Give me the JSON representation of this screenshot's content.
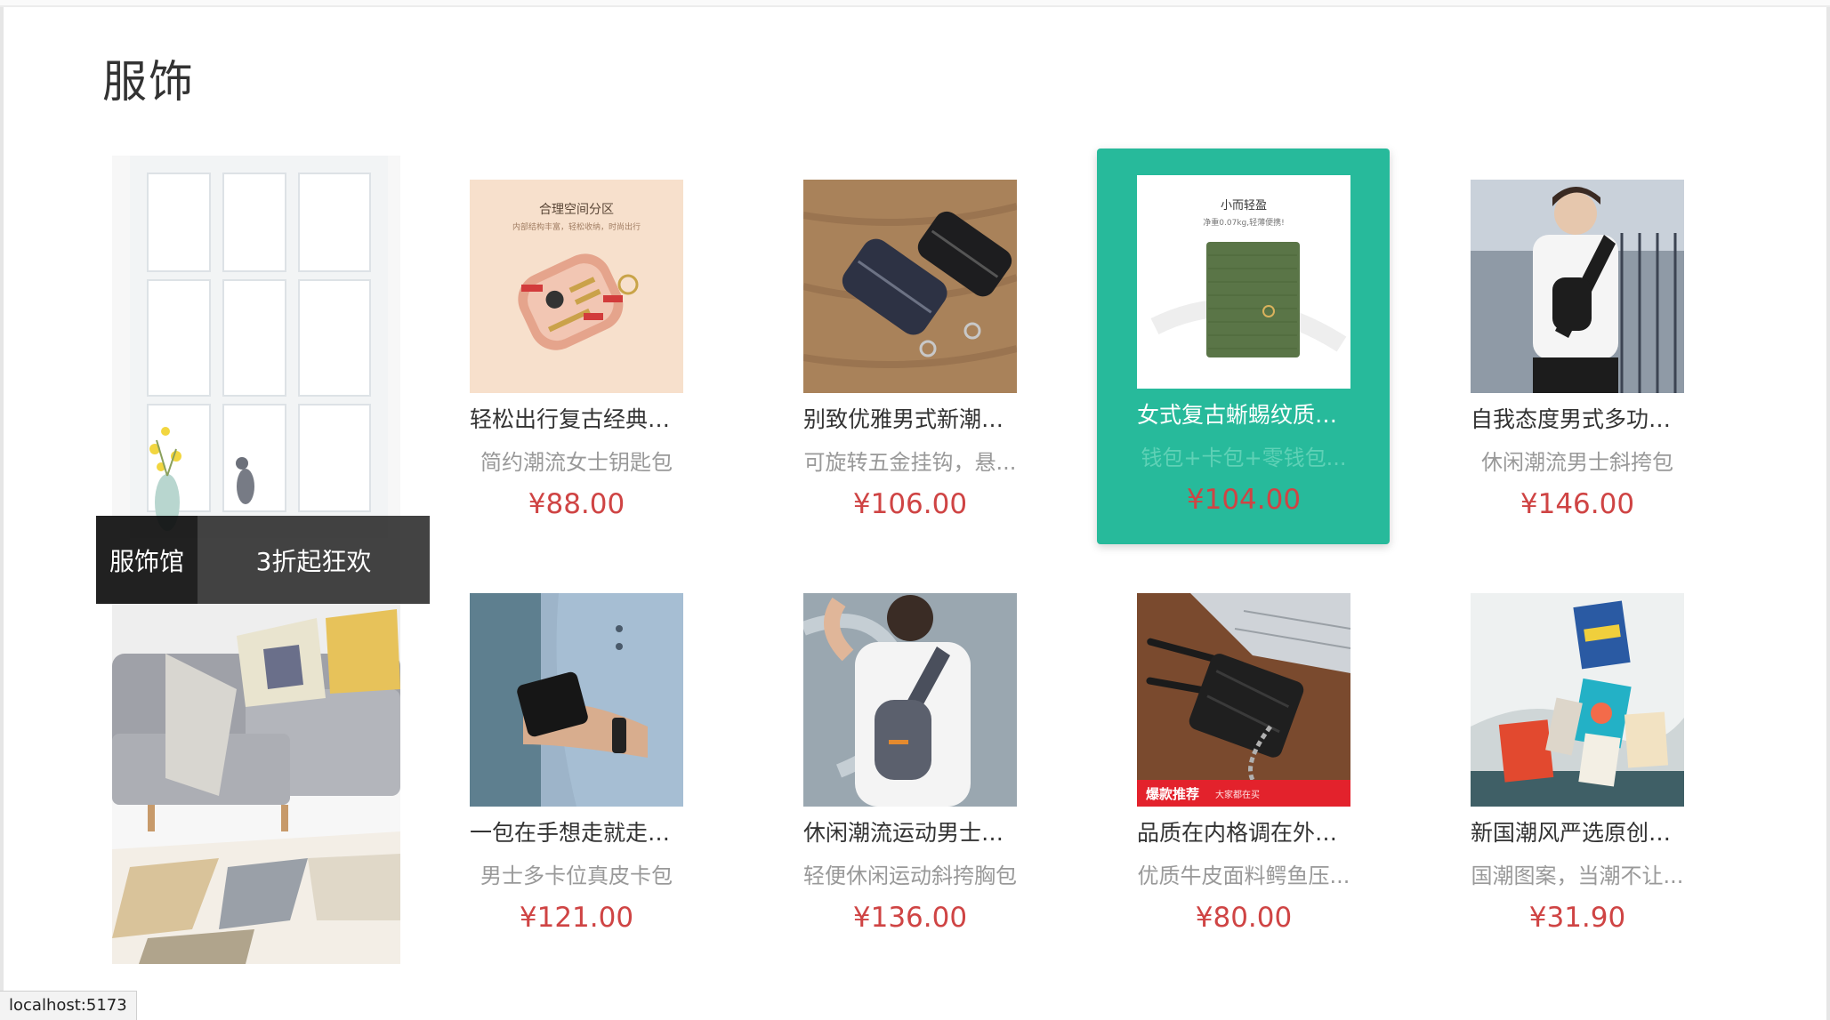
{
  "section": {
    "title": "服饰"
  },
  "promo": {
    "name": "服饰馆",
    "desc": "3折起狂欢"
  },
  "products": [
    {
      "name": "轻松出行复古经典老...",
      "desc": "简约潮流女士钥匙包",
      "price": "¥88.00",
      "image_icon": "key-pouch-image"
    },
    {
      "name": "别致优雅男式新潮头...",
      "desc": "可旋转五金挂钩，悬...",
      "price": "¥106.00",
      "image_icon": "key-case-image"
    },
    {
      "name": "女式复古蜥蜴纹质感...",
      "desc": "钱包+卡包+零钱包...",
      "price": "¥104.00",
      "image_icon": "green-wallet-image",
      "image_text": [
        "小而轻盈",
        "净重0.07kg,轻薄便携!"
      ]
    },
    {
      "name": "自我态度男式多功能...",
      "desc": "休闲潮流男士斜挎包",
      "price": "¥146.00",
      "image_icon": "sling-bag-model-image"
    },
    {
      "name": "一包在手想走就走男...",
      "desc": "男士多卡位真皮卡包",
      "price": "¥121.00",
      "image_icon": "card-wallet-hand-image"
    },
    {
      "name": "休闲潮流运动男士胸包",
      "desc": "轻便休闲运动斜挎胸包",
      "price": "¥136.00",
      "image_icon": "chest-bag-model-image"
    },
    {
      "name": "品质在内格调在外头...",
      "desc": "优质牛皮面料鳄鱼压...",
      "price": "¥80.00",
      "image_icon": "coin-purse-image",
      "image_badge": [
        "爆款推荐",
        "大家都在买"
      ]
    },
    {
      "name": "新国潮风严选原创蒸...",
      "desc": "国潮图案，当潮不让...",
      "price": "¥31.90",
      "image_icon": "gift-boxes-image"
    }
  ],
  "key_pouch_image_text": [
    "合理空间分区",
    "内部结构丰富，轻松收纳，时尚出行"
  ],
  "status_bar": {
    "url": "localhost:5173"
  },
  "colors": {
    "accent": "#27ba9b",
    "price": "#cf4444"
  }
}
